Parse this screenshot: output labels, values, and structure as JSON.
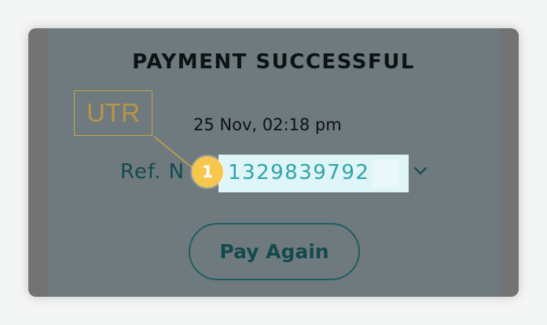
{
  "dialog": {
    "title": "PAYMENT SUCCESSFUL",
    "datetime": "25 Nov, 02:18 pm",
    "ref_label": "Ref. N",
    "ref_value": "1329839792",
    "pay_again_label": "Pay Again"
  },
  "annotation": {
    "utr_label": "UTR",
    "marker_number": "1"
  },
  "icons": {
    "expand": "chevron-down-icon"
  },
  "colors": {
    "overlay": "#6e7a7e",
    "title_text": "#0d1314",
    "teal_text": "#134a4e",
    "highlight_bg": "#dff5f8",
    "highlight_text": "#2fa5ab",
    "annotation_gold": "#c3a34d",
    "marker_fill": "#f7c64d"
  }
}
